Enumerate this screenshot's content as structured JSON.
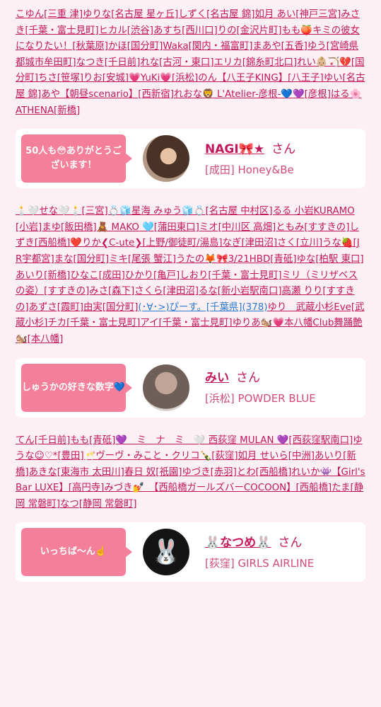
{
  "section1_names": "こゆん[三重 津]ゆりな[名古屋 星ヶ丘]しずく[名古屋 錦]如月 あい[神戸三宮]みさき[千葉・富士見町]ヒカル[渋谷]あすち[西川口]りの[金沢片町]もも🍑キミの彼女になりたい！[秋葉原]かほ[国分町]Waka[関内・福富町]まあや[五香]ゆう[宮崎県都城市牟田町]なつき[千日前]れな[古河・東口]エリカ[錦糸町北口]れい👶🏼🏹💔[国分町]ちさ[笹塚]りお[安城]💗YuKi💗[浜松]のん【八王子KING】[八王子]ゆい[名古屋 錦]あや【朝昼scenario】[西新宿]れおな🦁 L'Atelier-彦根-💙💜[彦根]はる🌸ATHENA[新橋]",
  "card1": {
    "badge": "50人も😳ありがとうございます！",
    "name": "NAGI🎀★",
    "san": "さん",
    "shop": "[成田] Honey&Be"
  },
  "section2_names": "🕯️🤍せな🤍🕯️[三宮]💍🧊星海 みゅう🧊💍[名古屋 中村区]るる 小岩KURAMO[小岩]まゆ[飯田橋]🧸 MAKO 🩵[蒲田東口]ミオ[中川区 高畑]ともみ[すすきの]しずき[西船橋]❤️りか❮C-ute❯[上野/御徒町/湯島]なぎ[津田沼]さく[立川]うな🍓[JR宇都宮]まな[国分町]ミキ[尾張 蟹江]うたの🦊🎀3/21HBD[青砥]ゆな[柏駅 東口]あいり[新橋]ひなこ[成田]ひかり[亀戸]しおり[千葉・富士見町]ミリ（ミリザベスの姿）[すすきの]みさ[森下]さくら[津田沼]るな[新小岩駅南口]高瀬 りり[すすきの]あずさ[霞町]由実[国分町]",
  "section2_blue": "(･∀･>)ぴーす。[千葉県](378)",
  "section2_tail": "ゆり　武蔵小杉Eve[武蔵小杉]チカ[千葉・富士見町]アイ[千葉・富士見町]ゆりあ🐿️💗本八幡Club舞踊艶🐿️[本八幡]",
  "card2": {
    "badge": "しゅうかの好きな数字💙",
    "name": "みい",
    "san": "さん",
    "shop": "[浜松] POWDER BLUE"
  },
  "section3_names": "てん[千日前]もも[青砥]💜　ミ　ナ　ミ　🤍 西荻窪 MULAN 💜[西荻窪駅南口]ゆうな☺︎♡*[豊田]🥂ヴーヴ・みこと・クリコ🍾[荻窪]如月 せいら[中洲]あいり[新橋]あきな[東海市 太田川]春日 奴[祇園]ゆづき[赤羽]とわ[西船橋]れいか👾【Girl's Bar LUXE】[高円寺]みづき💅　【西船橋ガールズバーCOCOON】[西船橋]たま[静岡 常磐町]なつ[静岡 常磐町]",
  "card3": {
    "badge": "いっちば〜ん☝️",
    "name": "🐰なつめ🐰",
    "san": "さん",
    "shop": "[荻窪] GIRLS AIRLINE",
    "avatar_icon": "🐰"
  }
}
